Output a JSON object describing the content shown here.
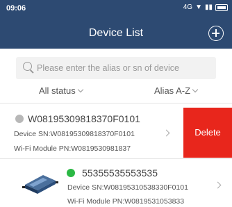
{
  "status_bar": {
    "time": "09:06",
    "network_label": "4G"
  },
  "header": {
    "title": "Device List"
  },
  "search": {
    "placeholder": "Please enter the alias or sn of device"
  },
  "filters": {
    "status_label": "All status",
    "sort_label": "Alias A-Z"
  },
  "devices": [
    {
      "alias": "W08195309818370F0101",
      "sn_line": "Device SN:W08195309818370F0101",
      "wifi_line": "Wi-Fi Module PN:W0819530981837",
      "status_color": "#b8b8b8",
      "delete_label": "Delete"
    },
    {
      "alias": "55355535553535",
      "sn_line": "Device SN:W08195310538330F0101",
      "wifi_line": "Wi-Fi Module PN:W0819531053833",
      "status_color": "#2bb844"
    }
  ],
  "colors": {
    "header_bg": "#2d4a72",
    "delete_bg": "#e8261c"
  }
}
